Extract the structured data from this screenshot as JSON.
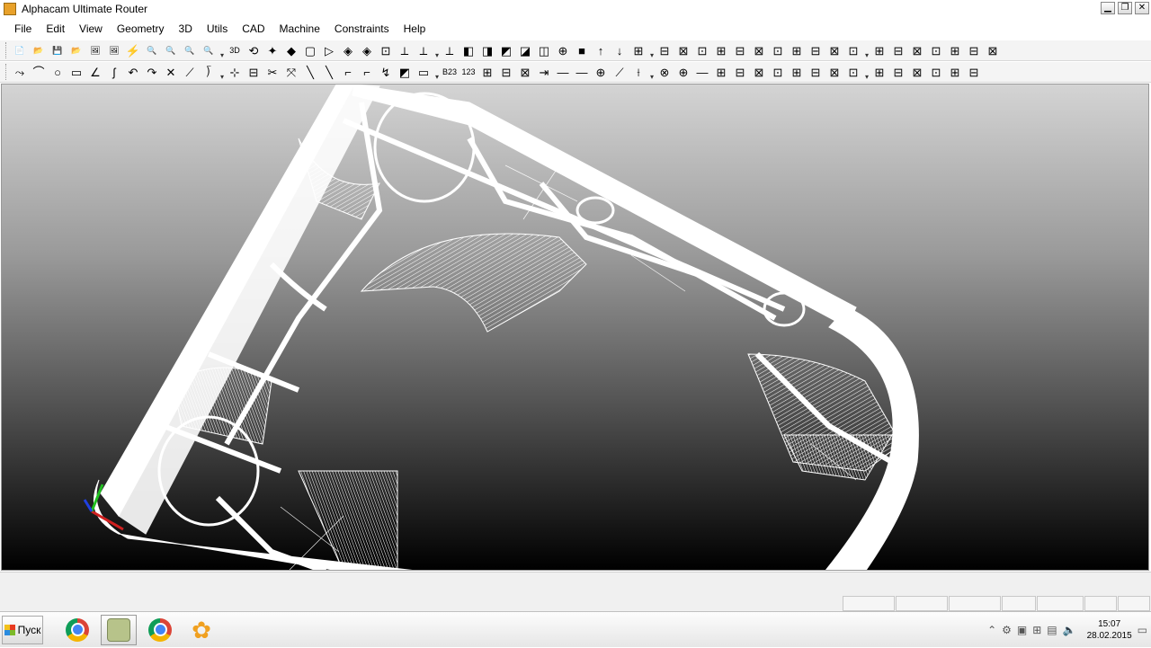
{
  "window": {
    "title": "Alphacam Ultimate Router",
    "controls": [
      "minimize-icon",
      "restore-icon",
      "close-icon"
    ]
  },
  "menu": [
    "File",
    "Edit",
    "View",
    "Geometry",
    "3D",
    "Utils",
    "CAD",
    "Machine",
    "Constraints",
    "Help"
  ],
  "toolbar1_icons": [
    "📄",
    "📂",
    "💾",
    "📂",
    "🖼",
    "🖼",
    "⚡",
    "🔍",
    "🔍",
    "🔍",
    "🔍",
    "3D",
    "⟲",
    "✦",
    "◆",
    "▢",
    "▷",
    "◈",
    "◈",
    "⊡",
    "⟂",
    "⟂",
    "⟂",
    "◧",
    "◨",
    "◩",
    "◪",
    "◫",
    "⊕",
    "■",
    "↑",
    "↓",
    "⊞",
    "⊟",
    "⊠",
    "⊡",
    "⊞",
    "⊟",
    "⊠",
    "⊡",
    "⊞",
    "⊟",
    "⊠",
    "⊡",
    "⊞",
    "⊟",
    "⊠",
    "⊡",
    "⊞",
    "⊟",
    "⊠"
  ],
  "toolbar2_icons": [
    "⤳",
    "⌒",
    "○",
    "▭",
    "∠",
    "ʃ",
    "↶",
    "↷",
    "✕",
    "⟋",
    "⟌",
    "⊹",
    "⊟",
    "✂",
    "⤧",
    "╲",
    "╲",
    "⌐",
    "⌐",
    "↯",
    "◩",
    "▭",
    "B23",
    "123",
    "⊞",
    "⊟",
    "⊠",
    "⇥",
    "—",
    "—",
    "⊕",
    "⟋",
    "⟊",
    "⊗",
    "⊕",
    "—",
    "⊞",
    "⊟",
    "⊠",
    "⊡",
    "⊞",
    "⊟",
    "⊠",
    "⊡",
    "⊞",
    "⊟",
    "⊠",
    "⊡",
    "⊞",
    "⊟"
  ],
  "taskbar": {
    "start_label": "Пуск",
    "time": "15:07",
    "date": "28.02.2015"
  },
  "colors": {
    "axis_x": "#d02020",
    "axis_y": "#20c020",
    "axis_z": "#2040e0"
  }
}
